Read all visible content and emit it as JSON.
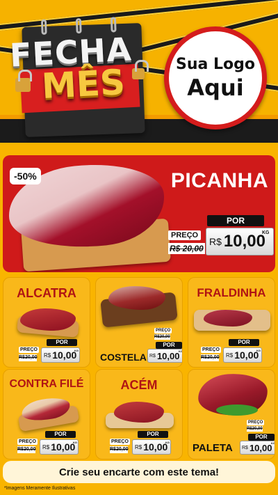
{
  "header": {
    "title_line1": "FECHA",
    "title_line2": "MÊS",
    "logo_line1": "Sua Logo",
    "logo_line2": "Aqui"
  },
  "featured": {
    "name": "PICANHA",
    "discount": "-50%",
    "preco_label": "PREÇO",
    "old_price": "R$ 20,00",
    "por_label": "POR",
    "currency": "R$",
    "new_price": "10,00",
    "unit": "KG"
  },
  "products": [
    {
      "name": "ALCATRA",
      "preco_label": "PREÇO",
      "old_price": "R$20,00",
      "por_label": "POR",
      "currency": "R$",
      "new_price": "10,00",
      "unit": "KG"
    },
    {
      "name": "COSTELA",
      "preco_label": "PREÇO",
      "old_price": "R$20,00",
      "por_label": "POR",
      "currency": "R$",
      "new_price": "10,00",
      "unit": "KG"
    },
    {
      "name": "FRALDINHA",
      "preco_label": "PREÇO",
      "old_price": "R$20,00",
      "por_label": "POR",
      "currency": "R$",
      "new_price": "10,00",
      "unit": "KG"
    },
    {
      "name": "CONTRA FILÉ",
      "preco_label": "PREÇO",
      "old_price": "R$20,00",
      "por_label": "POR",
      "currency": "R$",
      "new_price": "10,00",
      "unit": "KG"
    },
    {
      "name": "ACÉM",
      "preco_label": "PREÇO",
      "old_price": "R$20,00",
      "por_label": "POR",
      "currency": "R$",
      "new_price": "10,00",
      "unit": "KG"
    },
    {
      "name": "PALETA",
      "preco_label": "PREÇO",
      "old_price": "R$20,00",
      "por_label": "POR",
      "currency": "R$",
      "new_price": "10,00",
      "unit": "KG"
    }
  ],
  "footer": {
    "cta": "Crie seu encarte com este tema!",
    "disclaimer": "*Imagens Meramente Ilustrativas"
  },
  "colors": {
    "background": "#f9b400",
    "red": "#cf1a1a",
    "dark": "#1b1b1b",
    "card": "#f9b81a"
  }
}
